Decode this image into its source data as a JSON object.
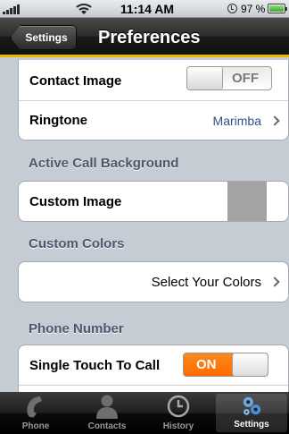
{
  "status_bar": {
    "time": "11:14 AM",
    "battery_percent": "97 %",
    "battery_level": 0.97,
    "signal_bars": 5
  },
  "nav": {
    "back_label": "Settings",
    "title": "Preferences"
  },
  "groups": {
    "contact": {
      "contact_image_label": "Contact Image",
      "contact_image_switch": "OFF",
      "ringtone_label": "Ringtone",
      "ringtone_value": "Marimba"
    },
    "active_call": {
      "header": "Active Call Background",
      "custom_image_label": "Custom Image"
    },
    "custom_colors": {
      "header": "Custom Colors",
      "select_label": "Select Your Colors"
    },
    "phone_number": {
      "header": "Phone Number",
      "single_touch_label": "Single Touch To Call",
      "single_touch_switch": "ON"
    }
  },
  "tabs": [
    {
      "label": "Phone",
      "icon": "phone-icon"
    },
    {
      "label": "Contacts",
      "icon": "person-icon"
    },
    {
      "label": "History",
      "icon": "clock-icon"
    },
    {
      "label": "Settings",
      "icon": "gears-icon",
      "active": true
    }
  ],
  "colors": {
    "accent": "#e6b800",
    "switch_on": "#ff7a00",
    "value_text": "#324f85"
  }
}
